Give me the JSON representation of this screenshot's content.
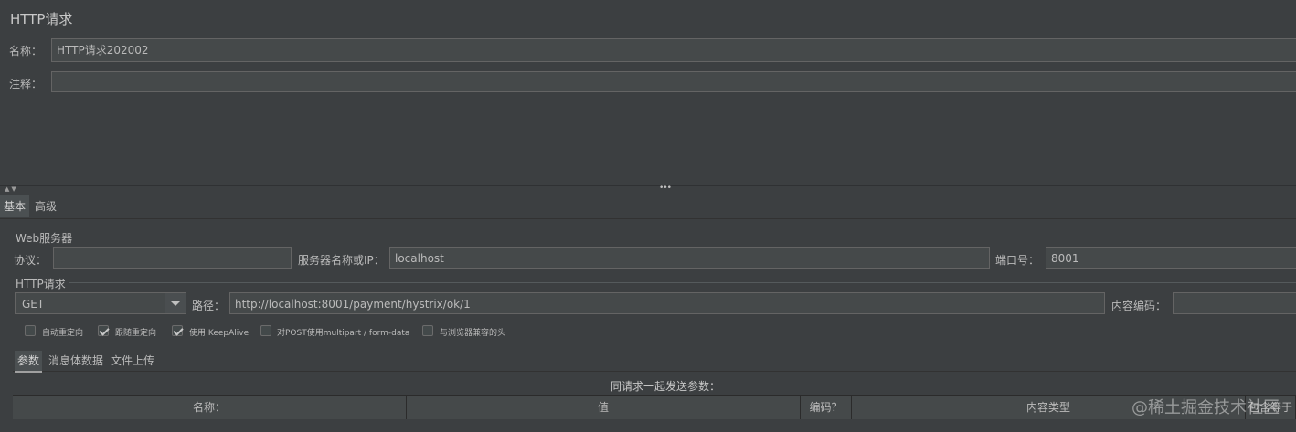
{
  "panel": {
    "title": "HTTP请求",
    "name_label": "名称：",
    "name_value": "HTTP请求202002",
    "comment_label": "注释：",
    "comment_value": ""
  },
  "splitter": {
    "arrows": "▲▼",
    "grip": "•••"
  },
  "tabs": {
    "basic": "基本",
    "advanced": "高级"
  },
  "web_server": {
    "section_title": "Web服务器",
    "protocol_label": "协议：",
    "protocol_value": "",
    "server_label": "服务器名称或IP：",
    "server_value": "localhost",
    "port_label": "端口号：",
    "port_value": "8001"
  },
  "http_request": {
    "section_title": "HTTP请求",
    "method": "GET",
    "path_label": "路径：",
    "path_value": "http://localhost:8001/payment/hystrix/ok/1",
    "encoding_label": "内容编码：",
    "encoding_value": ""
  },
  "options": [
    {
      "label": "自动重定向",
      "checked": false
    },
    {
      "label": "跟随重定向",
      "checked": true
    },
    {
      "label": "使用 KeepAlive",
      "checked": true
    },
    {
      "label": "对POST使用multipart / form-data",
      "checked": false
    },
    {
      "label": "与浏览器兼容的头",
      "checked": false
    }
  ],
  "param_tabs": {
    "params": "参数",
    "body": "消息体数据",
    "files": "文件上传"
  },
  "params_table": {
    "caption": "同请求一起发送参数：",
    "columns": [
      "名称：",
      "值",
      "编码？",
      "内容类型",
      "包含等于"
    ]
  },
  "watermark": "@稀土掘金技术社区"
}
